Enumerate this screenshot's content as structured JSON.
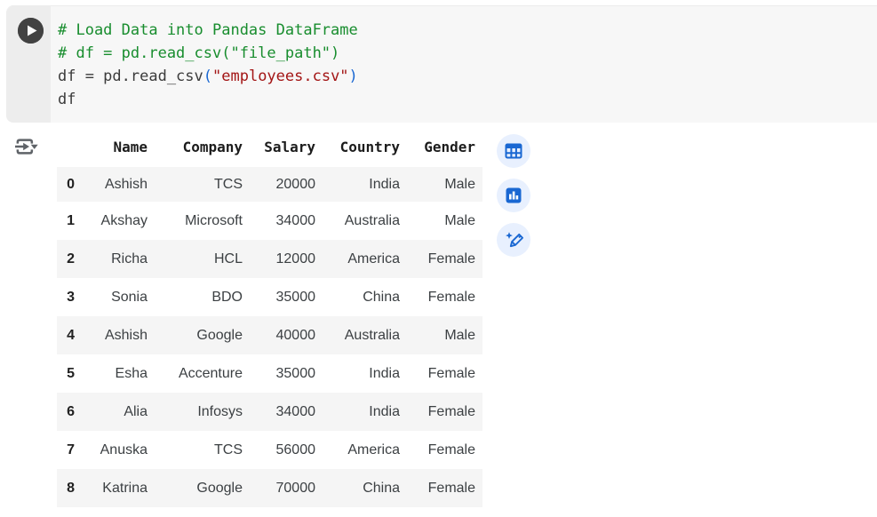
{
  "colors": {
    "accent_blue": "#1967d2",
    "comment_green": "#188d2e",
    "string_red": "#a31515",
    "cell_background": "#f7f7f7",
    "gutter_background": "#ededed",
    "row_stripe": "#f5f5f5",
    "run_button": "#424242",
    "toolbar_circle": "#e8f0fe"
  },
  "icons": {
    "run": "play-icon",
    "output_options": "output-options-arrow-icon",
    "toolbar": [
      "interactive-table-icon",
      "suggested-charts-icon",
      "generate-code-sparkle-pencil-icon"
    ]
  },
  "code_cell": {
    "lines": [
      [
        {
          "t": "# Load Data into Pandas DataFrame",
          "c": "comment"
        }
      ],
      [
        {
          "t": "# df = pd.read_csv(\"file_path\")",
          "c": "comment"
        }
      ],
      [
        {
          "t": "df = pd.read_csv",
          "c": "plain"
        },
        {
          "t": "(",
          "c": "bracket"
        },
        {
          "t": "\"employees.csv\"",
          "c": "string"
        },
        {
          "t": ")",
          "c": "bracket"
        }
      ],
      [
        {
          "t": "df",
          "c": "plain"
        }
      ]
    ]
  },
  "output": {
    "dataframe": {
      "index_header": "",
      "columns": [
        "Name",
        "Company",
        "Salary",
        "Country",
        "Gender"
      ],
      "rows": [
        {
          "index": "0",
          "cells": [
            "Ashish",
            "TCS",
            "20000",
            "India",
            "Male"
          ]
        },
        {
          "index": "1",
          "cells": [
            "Akshay",
            "Microsoft",
            "34000",
            "Australia",
            "Male"
          ]
        },
        {
          "index": "2",
          "cells": [
            "Richa",
            "HCL",
            "12000",
            "America",
            "Female"
          ]
        },
        {
          "index": "3",
          "cells": [
            "Sonia",
            "BDO",
            "35000",
            "China",
            "Female"
          ]
        },
        {
          "index": "4",
          "cells": [
            "Ashish",
            "Google",
            "40000",
            "Australia",
            "Male"
          ]
        },
        {
          "index": "5",
          "cells": [
            "Esha",
            "Accenture",
            "35000",
            "India",
            "Female"
          ]
        },
        {
          "index": "6",
          "cells": [
            "Alia",
            "Infosys",
            "34000",
            "India",
            "Female"
          ]
        },
        {
          "index": "7",
          "cells": [
            "Anuska",
            "TCS",
            "56000",
            "America",
            "Female"
          ]
        },
        {
          "index": "8",
          "cells": [
            "Katrina",
            "Google",
            "70000",
            "China",
            "Female"
          ]
        }
      ]
    },
    "toolbar": {
      "items": [
        {
          "name": "interactive-table"
        },
        {
          "name": "suggested-charts"
        },
        {
          "name": "generate-code"
        }
      ]
    }
  }
}
